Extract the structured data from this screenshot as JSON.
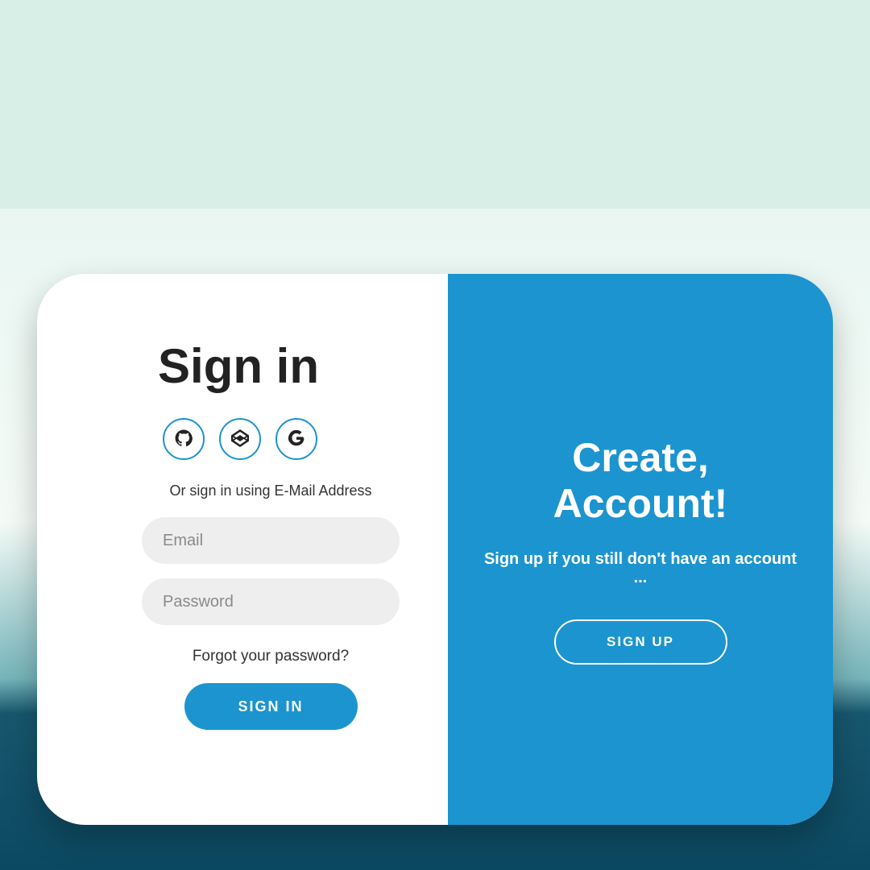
{
  "signin": {
    "title": "Sign in",
    "or_text": "Or sign in using E-Mail Address",
    "email_placeholder": "Email",
    "email_value": "",
    "password_placeholder": "Password",
    "password_value": "",
    "forgot": "Forgot your password?",
    "submit": "SIGN IN",
    "social": {
      "github": "github-icon",
      "codepen": "codepen-icon",
      "google": "google-icon"
    }
  },
  "signup": {
    "title": "Create, Account!",
    "subtitle": "Sign up if you still don't have an account ...",
    "button": "SIGN UP"
  },
  "colors": {
    "accent": "#1c94cf"
  }
}
